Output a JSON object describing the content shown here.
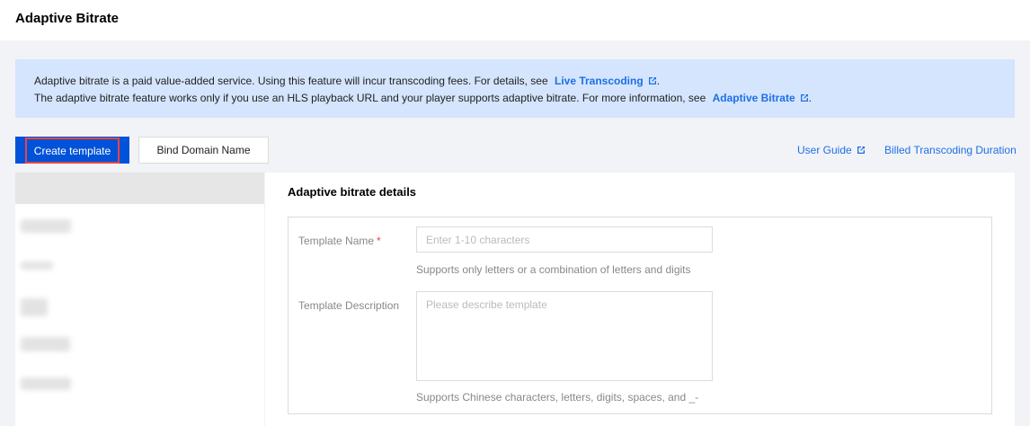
{
  "header": {
    "title": "Adaptive Bitrate"
  },
  "notice": {
    "line1_text": "Adaptive bitrate is a paid value-added service. Using this feature will incur transcoding fees. For details, see",
    "line1_link": "Live Transcoding",
    "line2_text": "The adaptive bitrate feature works only if you use an HLS playback URL and your player supports adaptive bitrate. For more information, see",
    "line2_link": "Adaptive Bitrate",
    "period": "."
  },
  "toolbar": {
    "create_label": "Create template",
    "bind_label": "Bind Domain Name",
    "user_guide_label": "User Guide",
    "billed_label": "Billed Transcoding Duration"
  },
  "details": {
    "title": "Adaptive bitrate details",
    "name_label": "Template Name",
    "required_mark": "*",
    "name_placeholder": "Enter 1-10 characters",
    "name_hint": "Supports only letters or a combination of letters and digits",
    "desc_label": "Template Description",
    "desc_placeholder": "Please describe template",
    "desc_hint": "Supports Chinese characters, letters, digits, spaces, and _-"
  },
  "colors": {
    "primary": "#0052d9",
    "link": "#1e6fe8",
    "notice_bg": "#d4e5fd",
    "highlight_border": "#e54545"
  }
}
